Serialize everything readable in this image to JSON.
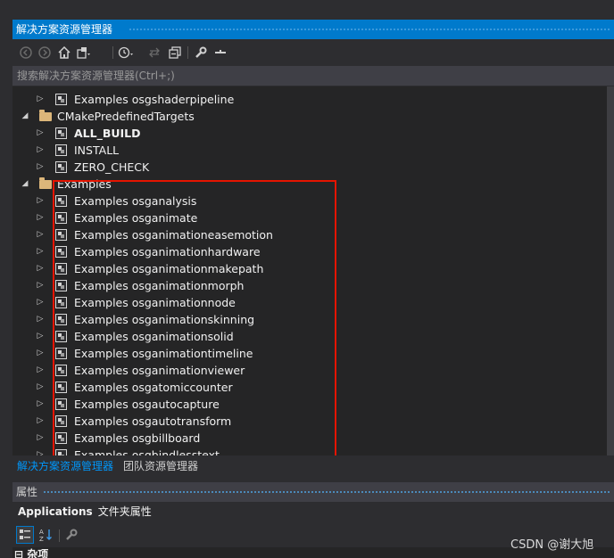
{
  "panel": {
    "title": "解决方案资源管理器",
    "search_placeholder": "搜索解决方案资源管理器(Ctrl+;)"
  },
  "toolbar": {
    "buttons": [
      {
        "icon": "back-icon"
      },
      {
        "icon": "forward-icon"
      },
      {
        "icon": "home-icon"
      },
      {
        "icon": "switch-views-icon"
      },
      {
        "icon": "history-icon"
      },
      {
        "icon": "sync-icon"
      },
      {
        "icon": "collapse-all-icon"
      },
      {
        "icon": "properties-wrench-icon"
      },
      {
        "icon": "preview-icon"
      }
    ]
  },
  "tree": {
    "rows": [
      {
        "label": "Examples osgshaderpipeline",
        "type": "project",
        "expanded": false,
        "bold": false
      },
      {
        "label": "CMakePredefinedTargets",
        "type": "folder",
        "expanded": true,
        "bold": false
      },
      {
        "label": "ALL_BUILD",
        "type": "project",
        "expanded": false,
        "bold": true
      },
      {
        "label": "INSTALL",
        "type": "project",
        "expanded": false,
        "bold": false
      },
      {
        "label": "ZERO_CHECK",
        "type": "project",
        "expanded": false,
        "bold": false
      },
      {
        "label": "Examples",
        "type": "folder",
        "expanded": true,
        "bold": false
      },
      {
        "label": "Examples osganalysis",
        "type": "project",
        "expanded": false,
        "bold": false
      },
      {
        "label": "Examples osganimate",
        "type": "project",
        "expanded": false,
        "bold": false
      },
      {
        "label": "Examples osganimationeasemotion",
        "type": "project",
        "expanded": false,
        "bold": false
      },
      {
        "label": "Examples osganimationhardware",
        "type": "project",
        "expanded": false,
        "bold": false
      },
      {
        "label": "Examples osganimationmakepath",
        "type": "project",
        "expanded": false,
        "bold": false
      },
      {
        "label": "Examples osganimationmorph",
        "type": "project",
        "expanded": false,
        "bold": false
      },
      {
        "label": "Examples osganimationnode",
        "type": "project",
        "expanded": false,
        "bold": false
      },
      {
        "label": "Examples osganimationskinning",
        "type": "project",
        "expanded": false,
        "bold": false
      },
      {
        "label": "Examples osganimationsolid",
        "type": "project",
        "expanded": false,
        "bold": false
      },
      {
        "label": "Examples osganimationtimeline",
        "type": "project",
        "expanded": false,
        "bold": false
      },
      {
        "label": "Examples osganimationviewer",
        "type": "project",
        "expanded": false,
        "bold": false
      },
      {
        "label": "Examples osgatomiccounter",
        "type": "project",
        "expanded": false,
        "bold": false
      },
      {
        "label": "Examples osgautocapture",
        "type": "project",
        "expanded": false,
        "bold": false
      },
      {
        "label": "Examples osgautotransform",
        "type": "project",
        "expanded": false,
        "bold": false
      },
      {
        "label": "Examples osgbillboard",
        "type": "project",
        "expanded": false,
        "bold": false
      },
      {
        "label": "Examples osgbindlesstext",
        "type": "project",
        "expanded": false,
        "bold": false
      }
    ]
  },
  "tabs": [
    {
      "label": "解决方案资源管理器",
      "active": true
    },
    {
      "label": "团队资源管理器",
      "active": false
    }
  ],
  "properties": {
    "title": "属性",
    "subject_name": "Applications",
    "subject_type": "文件夹属性",
    "category": "杂项"
  },
  "watermark": "CSDN @谢大旭",
  "colors": {
    "accent": "#007acc",
    "highlight_box": "#e51400",
    "active_tab": "#0097fb"
  }
}
